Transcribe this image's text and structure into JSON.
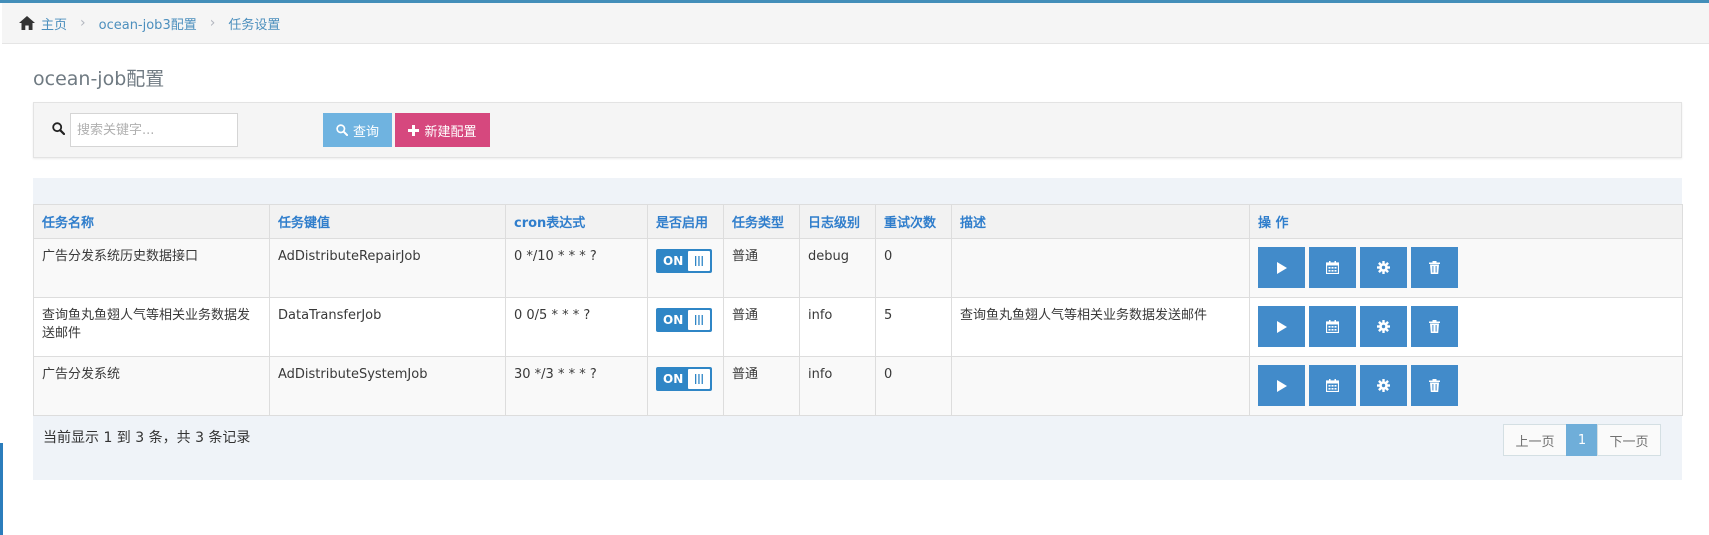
{
  "breadcrumb": {
    "home": "主页",
    "items": [
      "ocean-job3配置",
      "任务设置"
    ]
  },
  "page_title": "ocean-job配置",
  "search": {
    "placeholder": "搜索关键字...",
    "value": "",
    "query_label": "查询",
    "new_label": "新建配置"
  },
  "table": {
    "headers": [
      "任务名称",
      "任务键值",
      "cron表达式",
      "是否启用",
      "任务类型",
      "日志级别",
      "重试次数",
      "描述",
      "操 作"
    ],
    "rows": [
      {
        "name": "广告分发系统历史数据接口",
        "key": "AdDistributeRepairJob",
        "cron": "0 */10 * * * ?",
        "enabled": "ON",
        "type": "普通",
        "log_level": "debug",
        "retries": "0",
        "desc": ""
      },
      {
        "name": "查询鱼丸鱼翅人气等相关业务数据发送邮件",
        "key": "DataTransferJob",
        "cron": "0 0/5 * * * ?",
        "enabled": "ON",
        "type": "普通",
        "log_level": "info",
        "retries": "5",
        "desc": "查询鱼丸鱼翅人气等相关业务数据发送邮件"
      },
      {
        "name": "广告分发系统",
        "key": "AdDistributeSystemJob",
        "cron": "30 */3 * * * ?",
        "enabled": "ON",
        "type": "普通",
        "log_level": "info",
        "retries": "0",
        "desc": ""
      }
    ],
    "row_actions": [
      "play-icon",
      "calendar-icon",
      "gear-icon",
      "trash-icon"
    ]
  },
  "footer": {
    "info": "当前显示 1 到 3 条，共 3 条记录",
    "prev": "上一页",
    "current_page": "1",
    "next": "下一页"
  },
  "colors": {
    "accent": "#438eb9",
    "header_text": "#307ecc",
    "query_button": "#6fb3e0",
    "new_button": "#d6487e",
    "action_button": "#428bca",
    "toggle_on": "#2f86c6"
  }
}
